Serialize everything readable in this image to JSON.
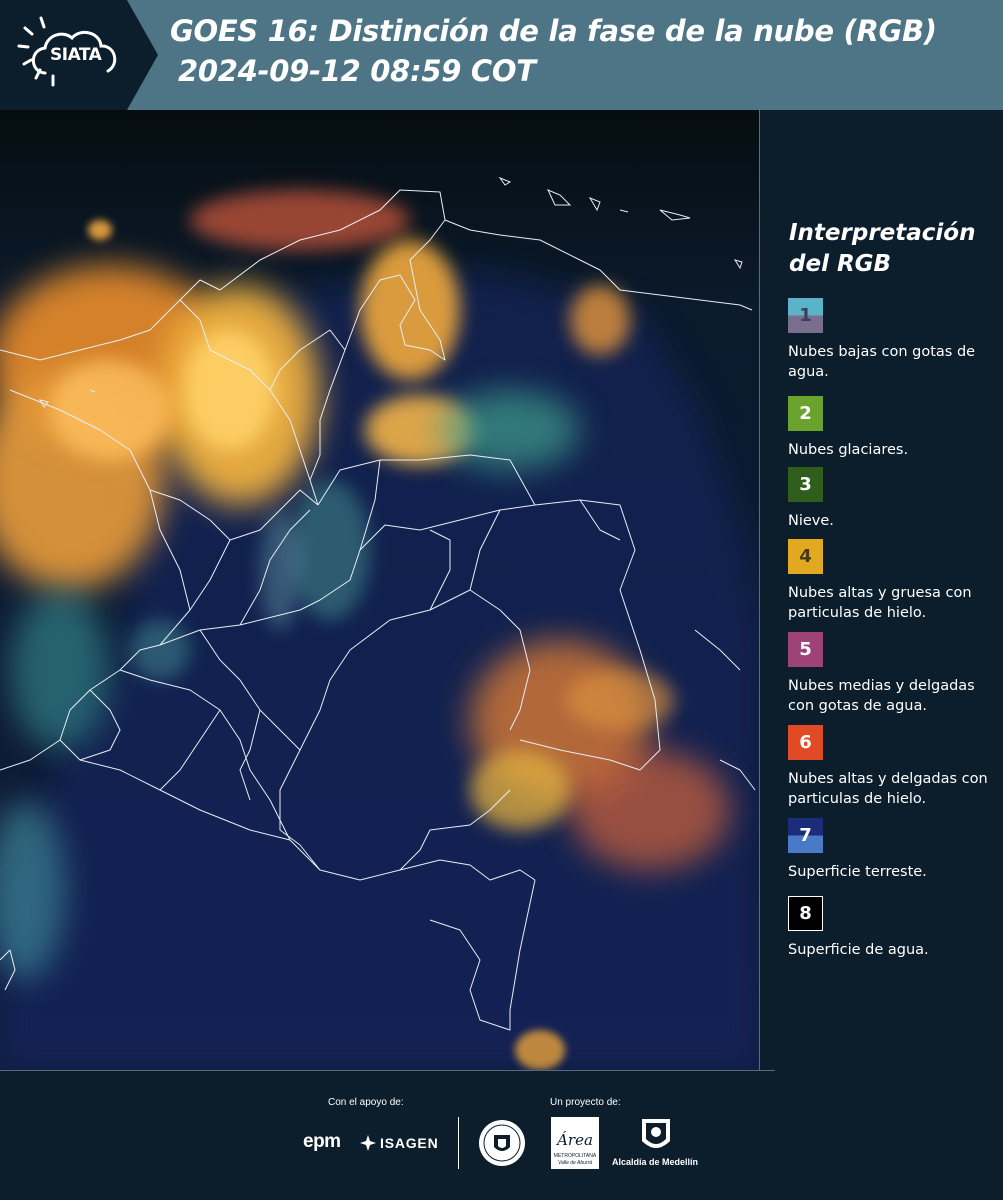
{
  "header": {
    "logo_text": "SIATA",
    "title_line1": "GOES 16: Distinción de la fase de la nube (RGB)",
    "title_line2": "2024-09-12 08:59 COT",
    "background_color": "#4e7585",
    "logo_tile_color": "#0c1d2b"
  },
  "map": {
    "product": "GOES 16 cloud phase distinction RGB"
  },
  "legend": {
    "title": "Interpretación del RGB",
    "items": [
      {
        "number": "1",
        "label": "Nubes bajas con gotas de agua.",
        "color": "#5ab3c6",
        "color_secondary": "#7a6e8e"
      },
      {
        "number": "2",
        "label": "Nubes glaciares.",
        "color": "#6aa22e"
      },
      {
        "number": "3",
        "label": "Nieve.",
        "color": "#2f5e1c"
      },
      {
        "number": "4",
        "label": "Nubes altas y gruesa con particulas de hielo.",
        "color": "#e1a820"
      },
      {
        "number": "5",
        "label": "Nubes medias y delgadas con gotas de agua.",
        "color": "#9e4378"
      },
      {
        "number": "6",
        "label": "Nubes altas y delgadas con particulas de hielo.",
        "color": "#e04b26"
      },
      {
        "number": "7",
        "label": "Superficie terreste.",
        "color": "#2b3c92",
        "color_secondary": "#4a79c8"
      },
      {
        "number": "8",
        "label": "Superficie de agua.",
        "color": "#000000"
      }
    ]
  },
  "footer": {
    "support_label": "Con el apoyo de:",
    "project_label": "Un proyecto de:",
    "epm_text": "epm",
    "isagen_text": "ISAGEN",
    "area_text": "Área",
    "area_subtext": "METROPOLITANA",
    "area_subtext2": "Valle de Aburrá",
    "alcaldia_text": "Alcaldía de Medellín"
  }
}
